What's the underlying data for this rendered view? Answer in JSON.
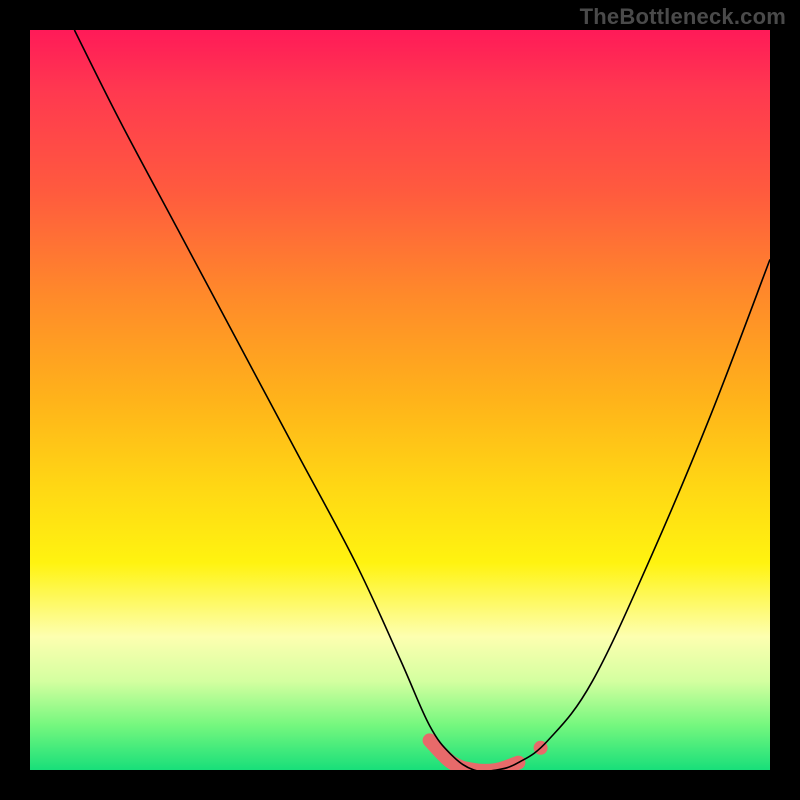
{
  "watermark_text": "TheBottleneck.com",
  "chart_data": {
    "type": "line",
    "title": "",
    "xlabel": "",
    "ylabel": "",
    "xlim": [
      0,
      100
    ],
    "ylim": [
      0,
      100
    ],
    "grid": false,
    "series": [
      {
        "name": "curve",
        "x": [
          6,
          12,
          20,
          28,
          36,
          44,
          50,
          54,
          57,
          60,
          63,
          66,
          70,
          76,
          84,
          92,
          100
        ],
        "y": [
          100,
          88,
          73,
          58,
          43,
          28,
          15,
          6,
          2,
          0,
          0,
          1,
          4,
          12,
          29,
          48,
          69
        ]
      }
    ],
    "highlight": {
      "name": "valley-band",
      "x": [
        54,
        57,
        60,
        63,
        66,
        69
      ],
      "y": [
        4,
        1,
        0,
        0,
        1,
        3
      ]
    },
    "background_gradient": {
      "stops": [
        {
          "pos": 0.0,
          "color": "#ff1a58"
        },
        {
          "pos": 0.22,
          "color": "#ff5b3e"
        },
        {
          "pos": 0.5,
          "color": "#ffb31a"
        },
        {
          "pos": 0.72,
          "color": "#fff310"
        },
        {
          "pos": 0.88,
          "color": "#d4ffa0"
        },
        {
          "pos": 1.0,
          "color": "#18df7a"
        }
      ]
    }
  }
}
